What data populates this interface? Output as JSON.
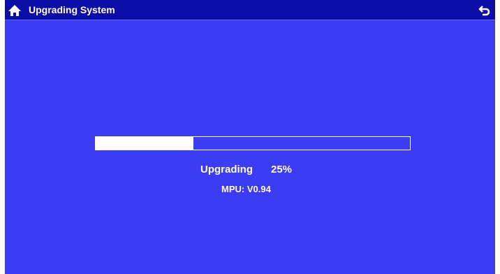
{
  "header": {
    "title": "Upgrading System",
    "home_icon": "home-icon",
    "back_icon": "back-arrow-icon"
  },
  "upgrade": {
    "status_label": "Upgrading",
    "percent_text": "25%",
    "progress_fraction": 0.31,
    "version_text": "MPU: V0.94"
  },
  "colors": {
    "background": "#3c3cf5",
    "titlebar": "#0d0da8",
    "text": "#ffffff"
  }
}
